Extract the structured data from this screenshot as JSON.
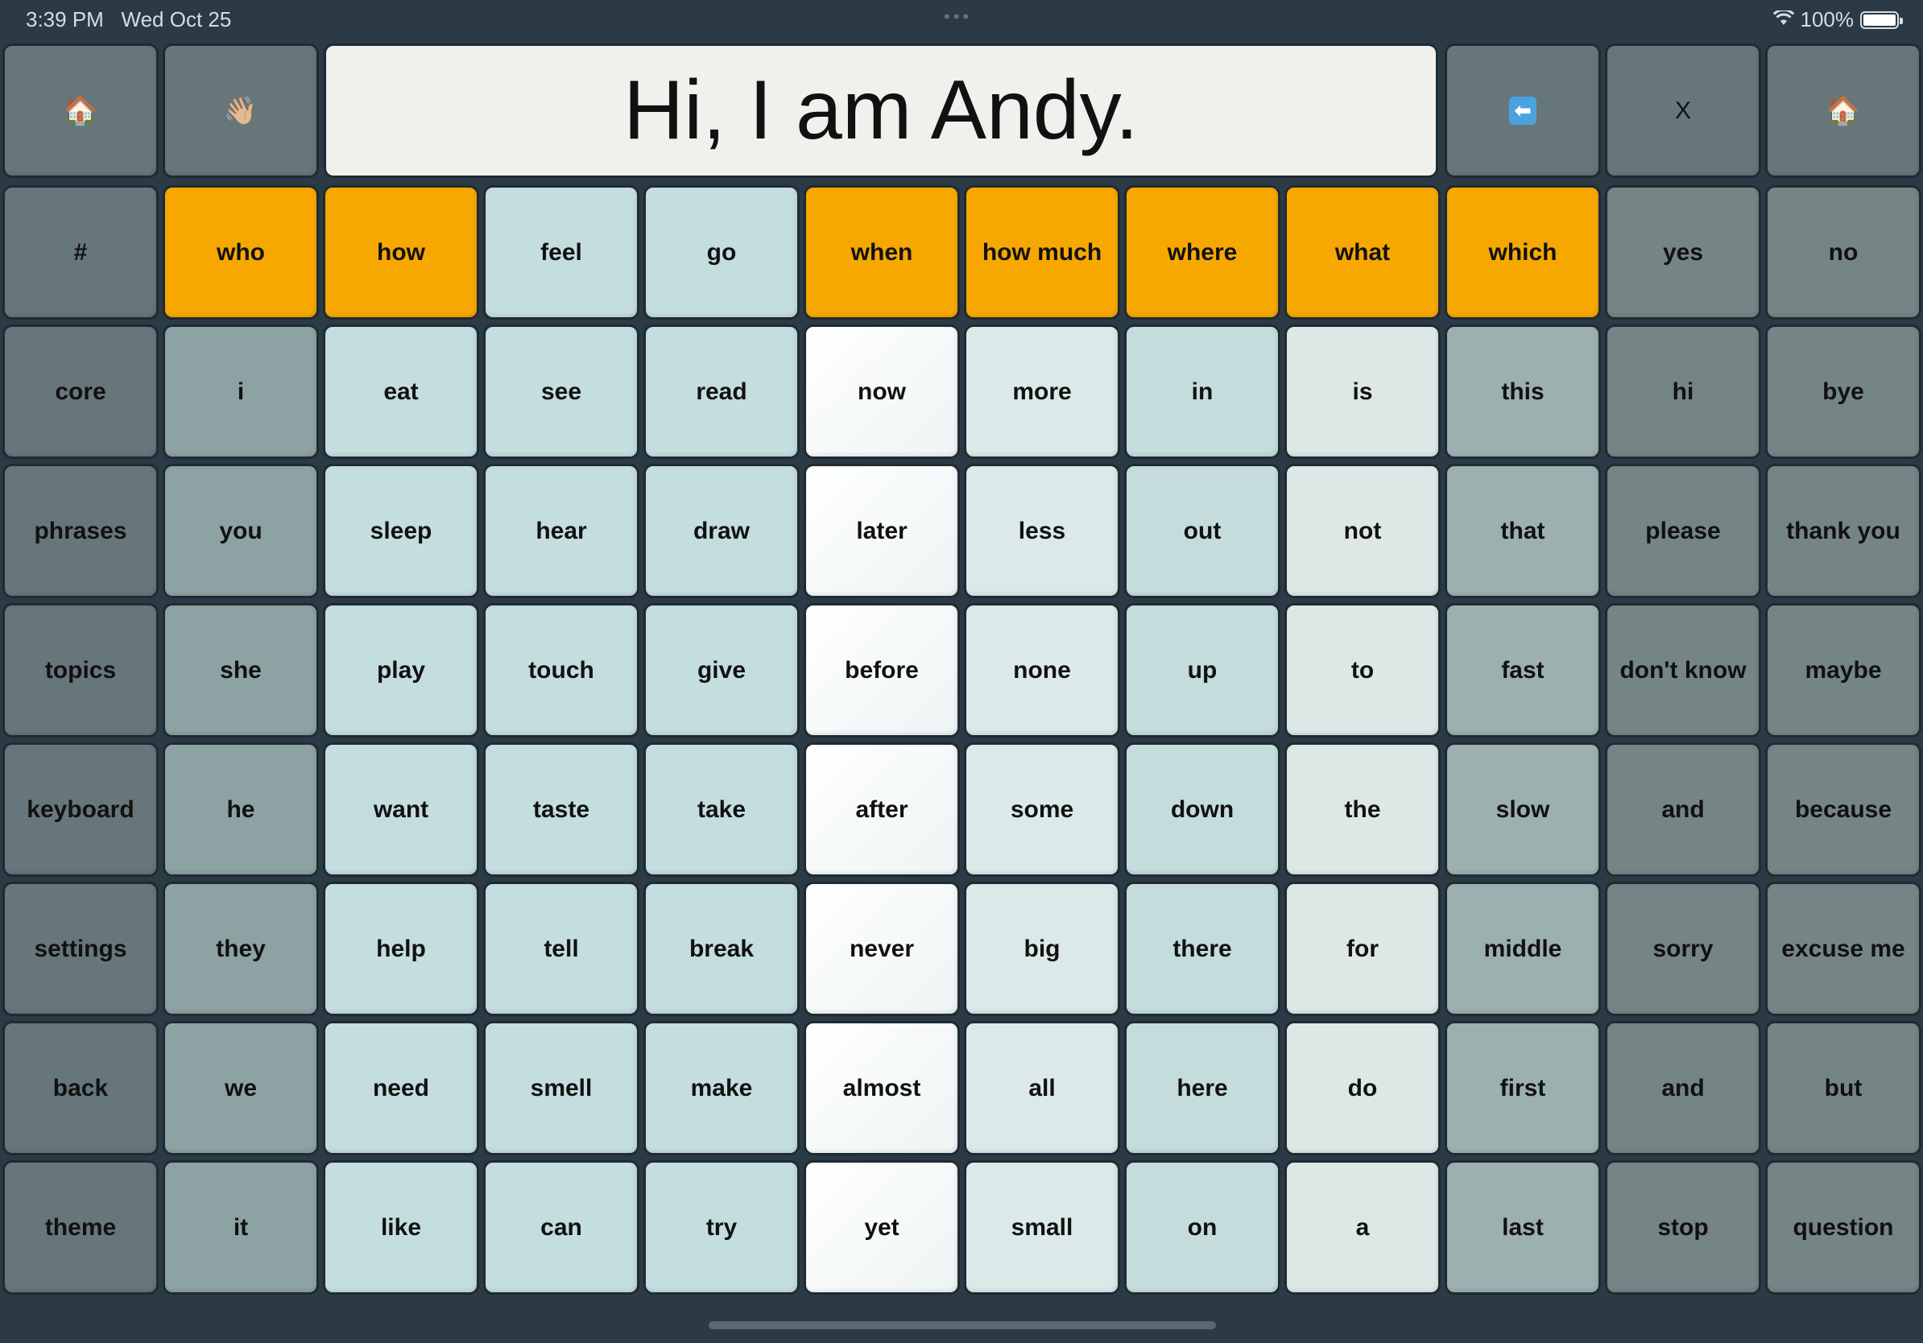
{
  "status": {
    "time": "3:39 PM",
    "date": "Wed Oct 25",
    "battery": "100%"
  },
  "message": "Hi, I am Andy.",
  "toolbar": [
    {
      "name": "home-button",
      "label": "🏠",
      "col": 0
    },
    {
      "name": "wave-button",
      "label": "👋🏼",
      "col": 1
    },
    {
      "name": "backspace-button",
      "label": "⬅",
      "col": 9
    },
    {
      "name": "clear-button",
      "label": "X",
      "col": 10
    },
    {
      "name": "home-right-button",
      "label": "🏠",
      "col": 11
    }
  ],
  "colors": {
    "question": "#f7a800",
    "navigation": "#67767a",
    "background": "#2b3a45"
  },
  "rows": [
    [
      "#",
      "who",
      "how",
      "feel",
      "go",
      "when",
      "how much",
      "where",
      "what",
      "which",
      "yes",
      "no"
    ],
    [
      "core",
      "i",
      "eat",
      "see",
      "read",
      "now",
      "more",
      "in",
      "is",
      "this",
      "hi",
      "bye"
    ],
    [
      "phrases",
      "you",
      "sleep",
      "hear",
      "draw",
      "later",
      "less",
      "out",
      "not",
      "that",
      "please",
      "thank you"
    ],
    [
      "topics",
      "she",
      "play",
      "touch",
      "give",
      "before",
      "none",
      "up",
      "to",
      "fast",
      "don't know",
      "maybe"
    ],
    [
      "keyboard",
      "he",
      "want",
      "taste",
      "take",
      "after",
      "some",
      "down",
      "the",
      "slow",
      "and",
      "because"
    ],
    [
      "settings",
      "they",
      "help",
      "tell",
      "break",
      "never",
      "big",
      "there",
      "for",
      "middle",
      "sorry",
      "excuse me"
    ],
    [
      "back",
      "we",
      "need",
      "smell",
      "make",
      "almost",
      "all",
      "here",
      "do",
      "first",
      "and",
      "but"
    ],
    [
      "theme",
      "it",
      "like",
      "can",
      "try",
      "yet",
      "small",
      "on",
      "a",
      "last",
      "stop",
      "question"
    ]
  ]
}
